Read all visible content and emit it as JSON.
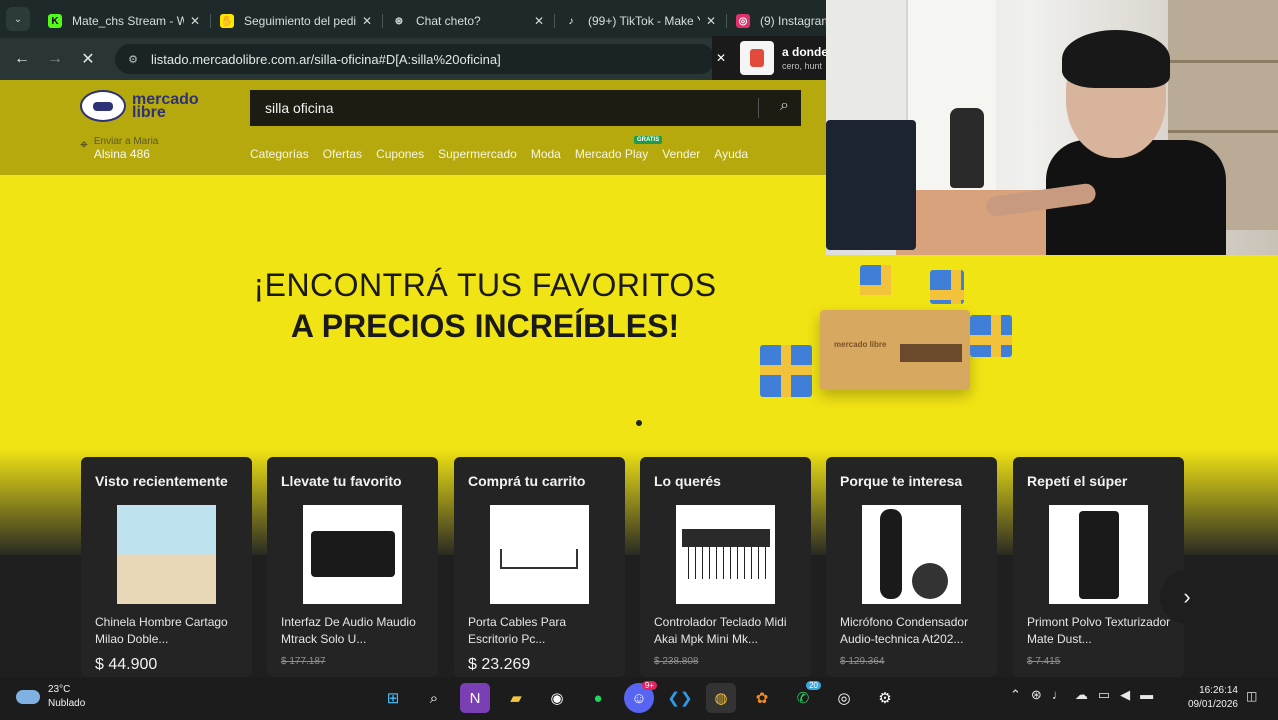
{
  "browser": {
    "tabs": [
      {
        "label": "Mate_chs Stream - W",
        "icon_color": "#53fc18"
      },
      {
        "label": "Seguimiento del pedi",
        "icon_color": "#ffe600"
      },
      {
        "label": "Chat cheto?",
        "icon_color": "#cfd8d8"
      },
      {
        "label": "(99+) TikTok - Make Y",
        "icon_color": "#ffffff"
      },
      {
        "label": "(9) Instagram",
        "icon_color": "#e1306c"
      }
    ],
    "url": "listado.mercadolibre.com.ar/silla-oficina#D[A:silla%20oficina]"
  },
  "toast": {
    "title": "a donde",
    "subtitle": "cero, hunt"
  },
  "ml": {
    "logo": "mercado libre",
    "search_value": "silla oficina",
    "location_line1": "Enviar a Maria",
    "location_line2": "Alsina 486",
    "menu": [
      "Categorías",
      "Ofertas",
      "Cupones",
      "Supermercado",
      "Moda",
      "Mercado Play",
      "Vender",
      "Ayuda"
    ],
    "gratis_badge": "GRATIS",
    "headline1": "¡ENCONTRÁ TUS FAVORITOS",
    "headline2": "A PRECIOS INCREÍBLES!",
    "box_logo": "mercado libre"
  },
  "cards": [
    {
      "title": "Visto recientemente",
      "name": "Chinela Hombre Cartago Milao Doble...",
      "old_price": "",
      "price": "$ 44.900"
    },
    {
      "title": "Llevate tu favorito",
      "name": "Interfaz De Audio Maudio Mtrack Solo U...",
      "old_price": "$ 177.187",
      "price": ""
    },
    {
      "title": "Comprá tu carrito",
      "name": "Porta Cables Para Escritorio Pc...",
      "old_price": "",
      "price": "$ 23.269"
    },
    {
      "title": "Lo querés",
      "name": "Controlador Teclado Midi Akai Mpk Mini Mk...",
      "old_price": "$ 238.808",
      "price": ""
    },
    {
      "title": "Porque te interesa",
      "name": "Micrófono Condensador Audio-technica At202...",
      "old_price": "$ 129.364",
      "price": ""
    },
    {
      "title": "Repetí el súper",
      "name": "Primont Polvo Texturizador Mate Dust...",
      "old_price": "$ 7.415",
      "price": ""
    }
  ],
  "taskbar": {
    "temp": "23°C",
    "condition": "Nublado",
    "time": "16:26:14",
    "date": "09/01/2026",
    "discord_badge": "9+",
    "whatsapp_badge": "20"
  }
}
